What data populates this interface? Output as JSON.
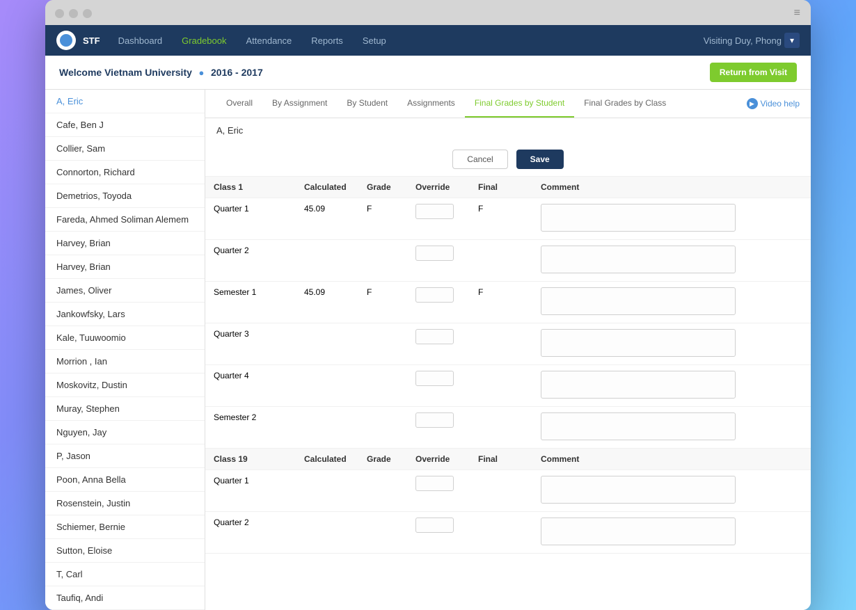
{
  "browser": {
    "menu_icon": "≡"
  },
  "nav": {
    "brand": "STF",
    "items": [
      {
        "label": "Dashboard",
        "active": false
      },
      {
        "label": "Gradebook",
        "active": true
      },
      {
        "label": "Attendance",
        "active": false
      },
      {
        "label": "Reports",
        "active": false
      },
      {
        "label": "Setup",
        "active": false
      }
    ],
    "user": "Visiting Duy, Phong",
    "dropdown": "▾"
  },
  "welcome": {
    "text": "Welcome Vietnam University",
    "dot": "●",
    "year": "2016 - 2017",
    "return_btn": "Return from Visit"
  },
  "students": [
    {
      "name": "A, Eric",
      "active": true
    },
    {
      "name": "Cafe, Ben J"
    },
    {
      "name": "Collier, Sam"
    },
    {
      "name": "Connorton, Richard"
    },
    {
      "name": "Demetrios, Toyoda"
    },
    {
      "name": "Fareda, Ahmed Soliman Alemem"
    },
    {
      "name": "Harvey, Brian"
    },
    {
      "name": "Harvey, Brian"
    },
    {
      "name": "James, Oliver"
    },
    {
      "name": "Jankowfsky, Lars"
    },
    {
      "name": "Kale, Tuuwoomio"
    },
    {
      "name": "Morrion , Ian"
    },
    {
      "name": "Moskovitz, Dustin"
    },
    {
      "name": "Muray, Stephen"
    },
    {
      "name": "Nguyen, Jay"
    },
    {
      "name": "P, Jason"
    },
    {
      "name": "Poon, Anna Bella"
    },
    {
      "name": "Rosenstein, Justin"
    },
    {
      "name": "Schiemer, Bernie"
    },
    {
      "name": "Sutton, Eloise"
    },
    {
      "name": "T, Carl"
    },
    {
      "name": "Taufiq, Andi"
    }
  ],
  "tabs": [
    {
      "label": "Overall",
      "active": false
    },
    {
      "label": "By Assignment",
      "active": false
    },
    {
      "label": "By Student",
      "active": false
    },
    {
      "label": "Assignments",
      "active": false
    },
    {
      "label": "Final Grades by Student",
      "active": true
    },
    {
      "label": "Final Grades by Class",
      "active": false
    }
  ],
  "video_help": "Video help",
  "student_name": "A, Eric",
  "cancel_btn": "Cancel",
  "save_btn": "Save",
  "columns": {
    "period": "",
    "calculated": "Calculated",
    "grade": "Grade",
    "override": "Override",
    "final": "Final",
    "comment": "Comment"
  },
  "class1": {
    "name": "Class 1",
    "calculated": "Calculated",
    "grade": "Grade",
    "override": "Override",
    "final": "Final",
    "comment": "Comment",
    "rows": [
      {
        "period": "Quarter 1",
        "calculated": "45.09",
        "grade": "F",
        "override": "",
        "final": "F",
        "comment": ""
      },
      {
        "period": "Quarter 2",
        "calculated": "",
        "grade": "",
        "override": "",
        "final": "",
        "comment": ""
      },
      {
        "period": "Semester 1",
        "calculated": "45.09",
        "grade": "F",
        "override": "",
        "final": "F",
        "comment": ""
      },
      {
        "period": "Quarter 3",
        "calculated": "",
        "grade": "",
        "override": "",
        "final": "",
        "comment": ""
      },
      {
        "period": "Quarter 4",
        "calculated": "",
        "grade": "",
        "override": "",
        "final": "",
        "comment": ""
      },
      {
        "period": "Semester 2",
        "calculated": "",
        "grade": "",
        "override": "",
        "final": "",
        "comment": ""
      }
    ]
  },
  "class19": {
    "name": "Class 19",
    "calculated": "Calculated",
    "grade": "Grade",
    "override": "Override",
    "final": "Final",
    "comment": "Comment",
    "rows": [
      {
        "period": "Quarter 1",
        "calculated": "",
        "grade": "",
        "override": "",
        "final": "",
        "comment": ""
      },
      {
        "period": "Quarter 2",
        "calculated": "",
        "grade": "",
        "override": "",
        "final": "",
        "comment": ""
      }
    ]
  }
}
